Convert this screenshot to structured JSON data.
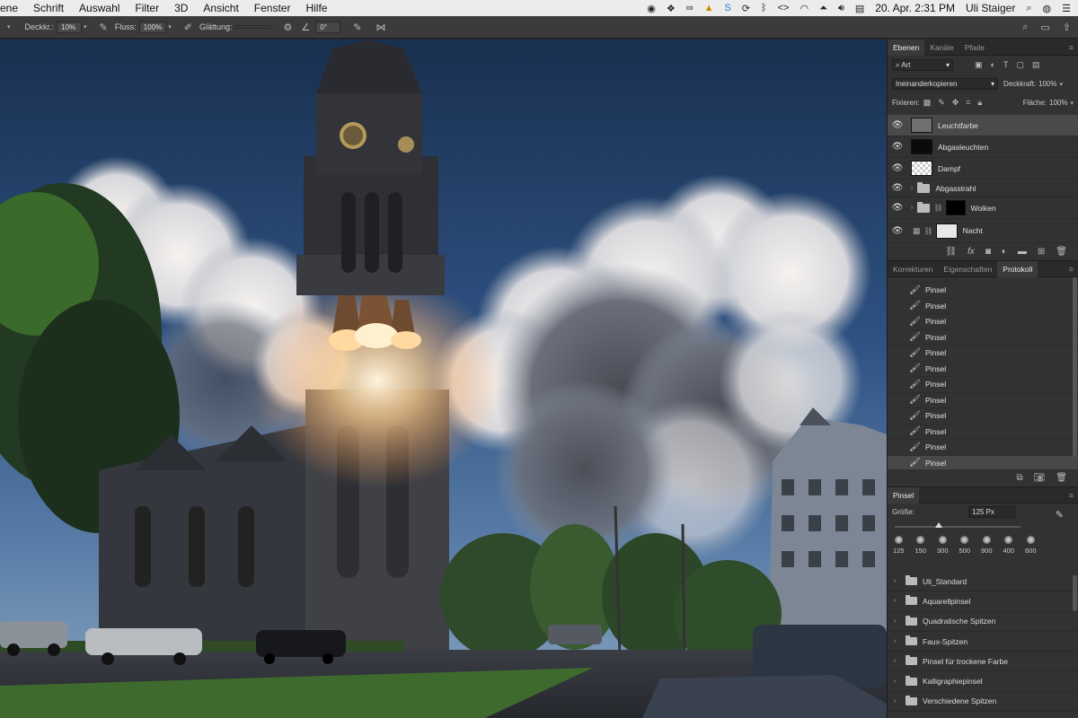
{
  "menubar": {
    "items": [
      "ene",
      "Schrift",
      "Auswahl",
      "Filter",
      "3D",
      "Ansicht",
      "Fenster",
      "Hilfe"
    ],
    "clock": "20. Apr.  2:31 PM",
    "user": "Uli Staiger"
  },
  "options": {
    "opacity_label": "Deckkr.:",
    "opacity_value": "10%",
    "flow_label": "Fluss:",
    "flow_value": "100%",
    "smoothing_label": "Glättung:",
    "smoothing_value": "",
    "angle_value": "0°"
  },
  "layers_panel": {
    "tabs": [
      "Ebenen",
      "Kanäle",
      "Pfade"
    ],
    "filter_value": "Art",
    "blend_mode": "Ineinanderkopieren",
    "opacity_label": "Deckkraft:",
    "opacity_value": "100%",
    "lock_label": "Fixieren:",
    "fill_label": "Fläche:",
    "fill_value": "100%",
    "layers": [
      {
        "name": "Leuchtfarbe",
        "selected": true
      },
      {
        "name": "Abgasleuchten"
      },
      {
        "name": "Dampf"
      },
      {
        "name": "Abgasstrahl",
        "group": true
      },
      {
        "name": "Wolken",
        "group": true
      },
      {
        "name": "Nacht"
      }
    ]
  },
  "history_panel": {
    "tabs": [
      "Korrekturen",
      "Eigenschaften",
      "Protokoll"
    ],
    "items": [
      "Pinsel",
      "Pinsel",
      "Pinsel",
      "Pinsel",
      "Pinsel",
      "Pinsel",
      "Pinsel",
      "Pinsel",
      "Pinsel",
      "Pinsel",
      "Pinsel",
      "Pinsel"
    ]
  },
  "brush_panel": {
    "title": "Pinsel",
    "size_label": "Größe:",
    "size_value": "125 Px",
    "size_fraction": 0.35,
    "presets": [
      "125",
      "150",
      "300",
      "500",
      "900",
      "400",
      "600"
    ],
    "groups": [
      "Uli_Standard",
      "Aquarellpinsel",
      "Quadratische Spitzen",
      "Faux-Spitzen",
      "Pinsel für trockene Farbe",
      "Kalligraphiepinsel",
      "Verschiedene Spitzen"
    ]
  },
  "colors": {
    "sky_top": "#1b3154",
    "sky_mid": "#35598a",
    "selected_row": "#4a4a4a",
    "panel_bg": "#323232"
  }
}
